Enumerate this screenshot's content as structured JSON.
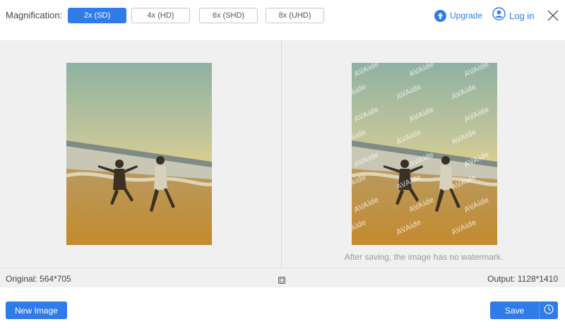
{
  "toolbar": {
    "magnification_label": "Magnification:",
    "options": [
      "2x (SD)",
      "4x (HD)",
      "6x (SHD)",
      "8x (UHD)"
    ],
    "selected_index": 0,
    "upgrade_label": "Upgrade",
    "login_label": "Log in"
  },
  "preview": {
    "watermark_text": "AVAide",
    "note": "After saving, the image has no watermark."
  },
  "status": {
    "original": "Original: 564*705",
    "output": "Output: 1128*1410"
  },
  "actions": {
    "new_image_label": "New Image",
    "save_label": "Save"
  },
  "colors": {
    "accent": "#2f7be9"
  },
  "icons": {
    "upgrade": "upgrade-arrow-icon",
    "login": "user-icon",
    "close": "close-icon",
    "compare": "compare-icon",
    "history": "clock-icon"
  }
}
